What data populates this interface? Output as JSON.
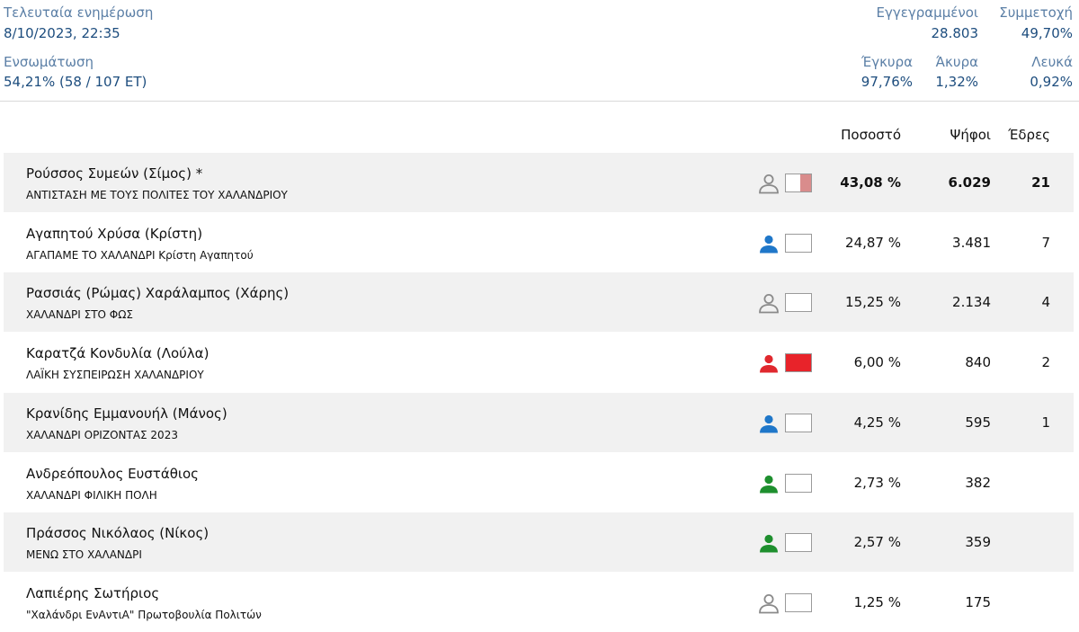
{
  "header": {
    "last_update_label": "Τελευταία ενημέρωση",
    "last_update_value": "8/10/2023, 22:35",
    "integration_label": "Ενσωμάτωση",
    "integration_value": "54,21% (58 / 107 ΕΤ)",
    "registered_label": "Εγγεγραμμένοι",
    "registered_value": "28.803",
    "turnout_label": "Συμμετοχή",
    "turnout_value": "49,70%",
    "valid_label": "Έγκυρα",
    "valid_value": "97,76%",
    "invalid_label": "Άκυρα",
    "invalid_value": "1,32%",
    "blank_label": "Λευκά",
    "blank_value": "0,92%"
  },
  "table": {
    "col_percent": "Ποσοστό",
    "col_votes": "Ψήφοι",
    "col_seats": "Έδρες",
    "rows": [
      {
        "name": "Ρούσσος Συμεών (Σίμος) *",
        "party": "ΑΝΤΙΣΤΑΣΗ ΜΕ ΤΟΥΣ ΠΟΛΙΤΕΣ ΤΟΥ ΧΑΛΑΝΔΡΙΟΥ",
        "percent": "43,08 %",
        "votes": "6.029",
        "seats": "21",
        "icon_color": "#8a8a8a",
        "bar_color": "#d98c8c",
        "bar_fill": 0.43,
        "bold": true
      },
      {
        "name": "Αγαπητού Χρύσα (Κρίστη)",
        "party": "ΑΓΑΠΑΜΕ ΤΟ ΧΑΛΑΝΔΡΙ Κρίστη Αγαπητού",
        "percent": "24,87 %",
        "votes": "3.481",
        "seats": "7",
        "icon_color": "#1f77c9",
        "bar_color": "#ffffff",
        "bar_fill": 0.0,
        "bold": false
      },
      {
        "name": "Ρασσιάς (Ρώμας) Χαράλαμπος (Χάρης)",
        "party": "ΧΑΛΑΝΔΡΙ ΣΤΟ ΦΩΣ",
        "percent": "15,25 %",
        "votes": "2.134",
        "seats": "4",
        "icon_color": "#8a8a8a",
        "bar_color": "#ffffff",
        "bar_fill": 0.0,
        "bold": false
      },
      {
        "name": "Καρατζά Κονδυλία (Λούλα)",
        "party": "ΛΑΪΚΗ ΣΥΣΠΕΙΡΩΣΗ ΧΑΛΑΝΔΡΙΟΥ",
        "percent": "6,00 %",
        "votes": "840",
        "seats": "2",
        "icon_color": "#e0282e",
        "bar_color": "#e8232a",
        "bar_fill": 1.0,
        "bold": false
      },
      {
        "name": "Κρανίδης Εμμανουήλ (Μάνος)",
        "party": "ΧΑΛΑΝΔΡΙ ΟΡΙΖΟΝΤΑΣ 2023",
        "percent": "4,25 %",
        "votes": "595",
        "seats": "1",
        "icon_color": "#1f77c9",
        "bar_color": "#ffffff",
        "bar_fill": 0.0,
        "bold": false
      },
      {
        "name": "Ανδρεόπουλος Ευστάθιος",
        "party": "ΧΑΛΑΝΔΡΙ ΦΙΛΙΚΗ ΠΟΛΗ",
        "percent": "2,73 %",
        "votes": "382",
        "seats": "",
        "icon_color": "#1e8f2e",
        "bar_color": "#ffffff",
        "bar_fill": 0.0,
        "bold": false
      },
      {
        "name": "Πράσσος Νικόλαος (Νίκος)",
        "party": "ΜΕΝΩ ΣΤΟ ΧΑΛΑΝΔΡΙ",
        "percent": "2,57 %",
        "votes": "359",
        "seats": "",
        "icon_color": "#1e8f2e",
        "bar_color": "#ffffff",
        "bar_fill": 0.0,
        "bold": false
      },
      {
        "name": "Λαπιέρης Σωτήριος",
        "party": "\"Χαλάνδρι ΕνΑντιΑ\" Πρωτοβουλία Πολιτών",
        "percent": "1,25 %",
        "votes": "175",
        "seats": "",
        "icon_color": "#8a8a8a",
        "bar_color": "#ffffff",
        "bar_fill": 0.0,
        "bold": false
      }
    ]
  }
}
